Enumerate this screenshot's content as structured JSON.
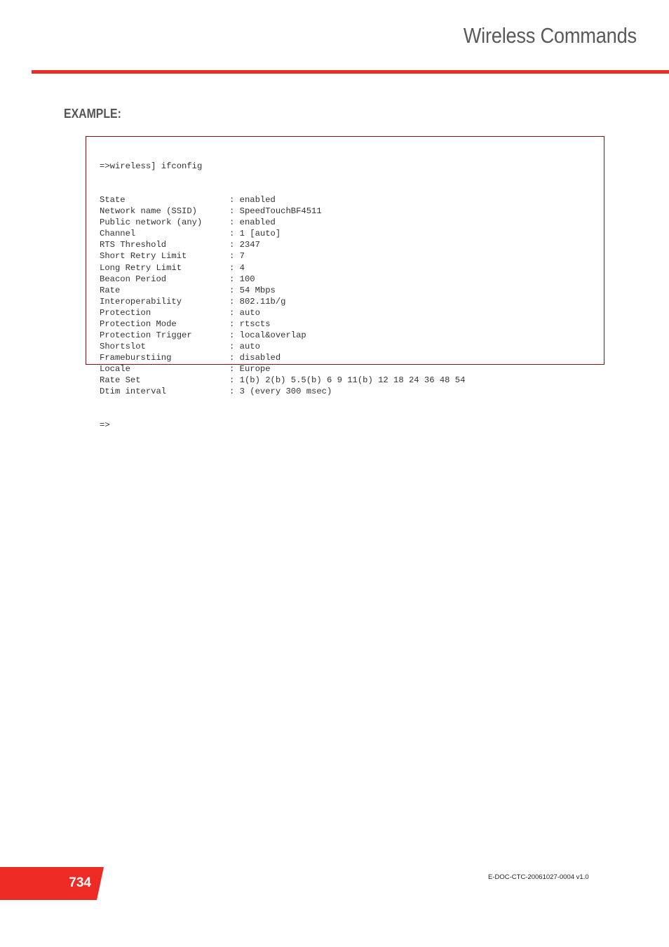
{
  "header": {
    "title": "Wireless Commands",
    "accent_color": "#ee2a24"
  },
  "section": {
    "label": "EXAMPLE:"
  },
  "code_example": {
    "command": "=>wireless] ifconfig",
    "rows": [
      {
        "key": "State",
        "value": ": enabled"
      },
      {
        "key": "Network name (SSID)",
        "value": ": SpeedTouchBF4511"
      },
      {
        "key": "Public network (any)",
        "value": ": enabled"
      },
      {
        "key": "Channel",
        "value": ": 1 [auto]"
      },
      {
        "key": "RTS Threshold",
        "value": ": 2347"
      },
      {
        "key": "Short Retry Limit",
        "value": ": 7"
      },
      {
        "key": "Long Retry Limit",
        "value": ": 4"
      },
      {
        "key": "Beacon Period",
        "value": ": 100"
      },
      {
        "key": "Rate",
        "value": ": 54 Mbps"
      },
      {
        "key": "Interoperability",
        "value": ": 802.11b/g"
      },
      {
        "key": "Protection",
        "value": ": auto"
      },
      {
        "key": "Protection Mode",
        "value": ": rtscts"
      },
      {
        "key": "Protection Trigger",
        "value": ": local&overlap"
      },
      {
        "key": "Shortslot",
        "value": ": auto"
      },
      {
        "key": "Frameburstiing",
        "value": ": disabled"
      },
      {
        "key": "Locale",
        "value": ": Europe"
      },
      {
        "key": "Rate Set",
        "value": ": 1(b) 2(b) 5.5(b) 6 9 11(b) 12 18 24 36 48 54"
      },
      {
        "key": "Dtim interval",
        "value": ": 3 (every 300 msec)"
      }
    ],
    "prompt": "=>",
    "border_color": "#7a1418"
  },
  "footer": {
    "page_number": "734",
    "doc_id": "E-DOC-CTC-20061027-0004 v1.0"
  }
}
